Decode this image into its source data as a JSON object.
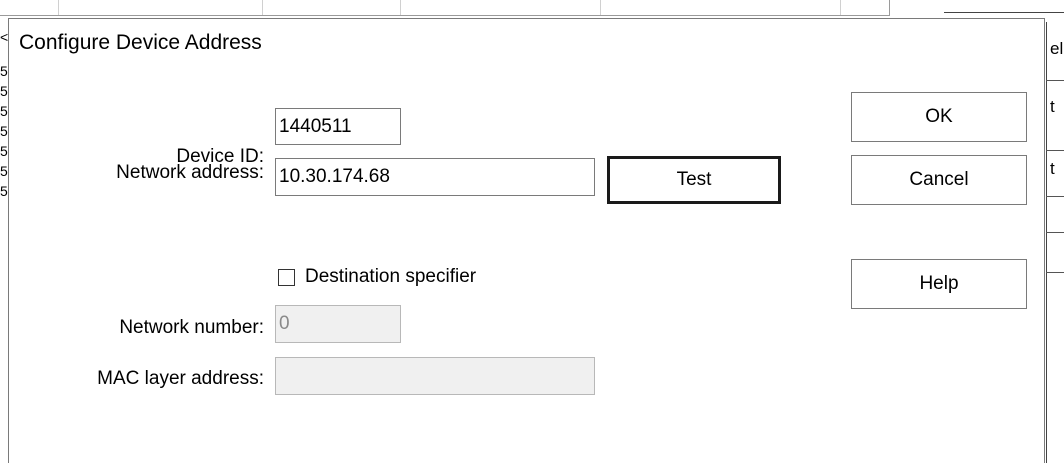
{
  "dialog": {
    "title": "Configure Device Address"
  },
  "fields": {
    "device_id": {
      "label": "Device ID:",
      "value": "1440511"
    },
    "network_address": {
      "label": "Network address:",
      "value": "10.30.174.68"
    },
    "destination_specifier": {
      "label": "Destination specifier",
      "checked": false
    },
    "network_number": {
      "label": "Network number:",
      "value": "0",
      "disabled": true
    },
    "mac_layer_address": {
      "label": "MAC layer address:",
      "value": "",
      "disabled": true
    }
  },
  "buttons": {
    "test": "Test",
    "ok": "OK",
    "cancel": "Cancel",
    "help": "Help"
  },
  "background": {
    "left_fragments": [
      "<",
      "5",
      "5",
      "5",
      "5",
      "5",
      "5",
      "5"
    ],
    "right_fragments": [
      "el",
      "t",
      "t"
    ]
  }
}
